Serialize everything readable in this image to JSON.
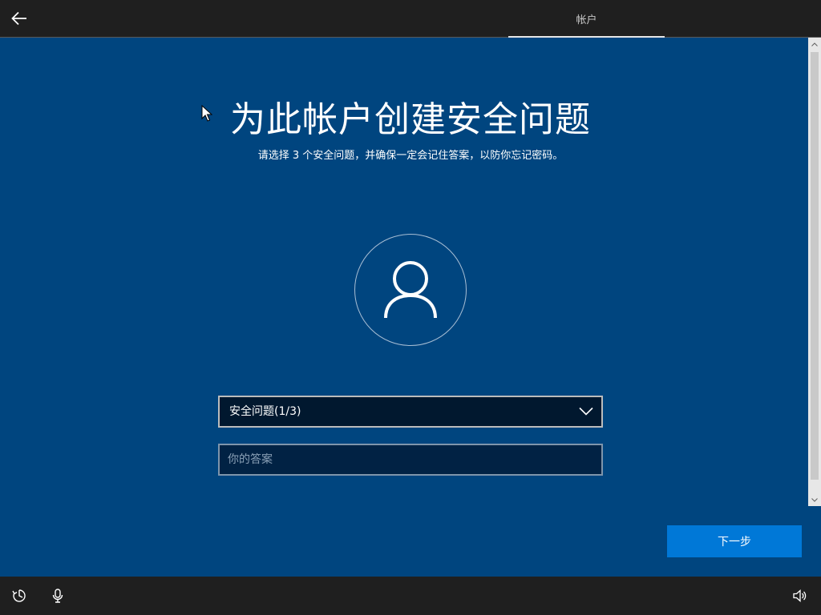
{
  "header": {
    "tab_label": "帐户"
  },
  "main": {
    "title": "为此帐户创建安全问题",
    "subtitle": "请选择 3 个安全问题，并确保一定会记住答案，以防你忘记密码。",
    "question_dropdown": {
      "selected": "安全问题(1/3)"
    },
    "answer_field": {
      "value": "",
      "placeholder": "你的答案"
    },
    "next_button_label": "下一步"
  },
  "icons": {
    "back": "back-arrow-icon",
    "avatar": "user-icon",
    "dropdown": "chevron-down-icon",
    "ease_of_access": "ease-of-access-icon",
    "microphone": "microphone-icon",
    "volume": "volume-icon"
  },
  "colors": {
    "background": "#00457f",
    "topbar": "#1f1f1f",
    "accent_button": "#0078d7",
    "input_background": "#01182f"
  }
}
